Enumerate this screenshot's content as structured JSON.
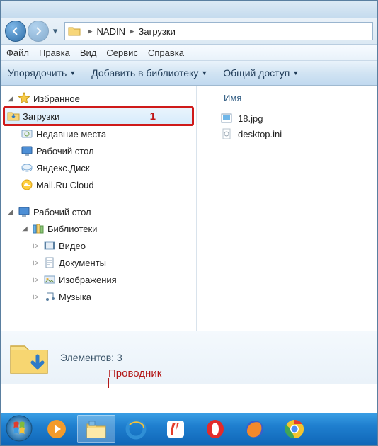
{
  "breadcrumb": {
    "root": "NADIN",
    "current": "Загрузки"
  },
  "menubar": {
    "file": "Файл",
    "edit": "Правка",
    "view": "Вид",
    "service": "Сервис",
    "help": "Справка"
  },
  "toolbar": {
    "organize": "Упорядочить",
    "addlib": "Добавить в библиотеку",
    "share": "Общий доступ"
  },
  "columns": {
    "name": "Имя"
  },
  "files": [
    {
      "name": "18.jpg"
    },
    {
      "name": "desktop.ini"
    }
  ],
  "nav": {
    "favorites_label": "Избранное",
    "favorites": [
      {
        "label": "Загрузки"
      },
      {
        "label": "Недавние места"
      },
      {
        "label": "Рабочий стол"
      },
      {
        "label": "Яндекс.Диск"
      },
      {
        "label": "Mail.Ru Cloud"
      }
    ],
    "desktop_label": "Рабочий стол",
    "libraries_label": "Библиотеки",
    "libraries": [
      {
        "label": "Видео"
      },
      {
        "label": "Документы"
      },
      {
        "label": "Изображения"
      },
      {
        "label": "Музыка"
      }
    ]
  },
  "annotations": {
    "marker1": "1",
    "explorer_label": "Проводник"
  },
  "status": {
    "elements_label": "Элементов: 3"
  }
}
